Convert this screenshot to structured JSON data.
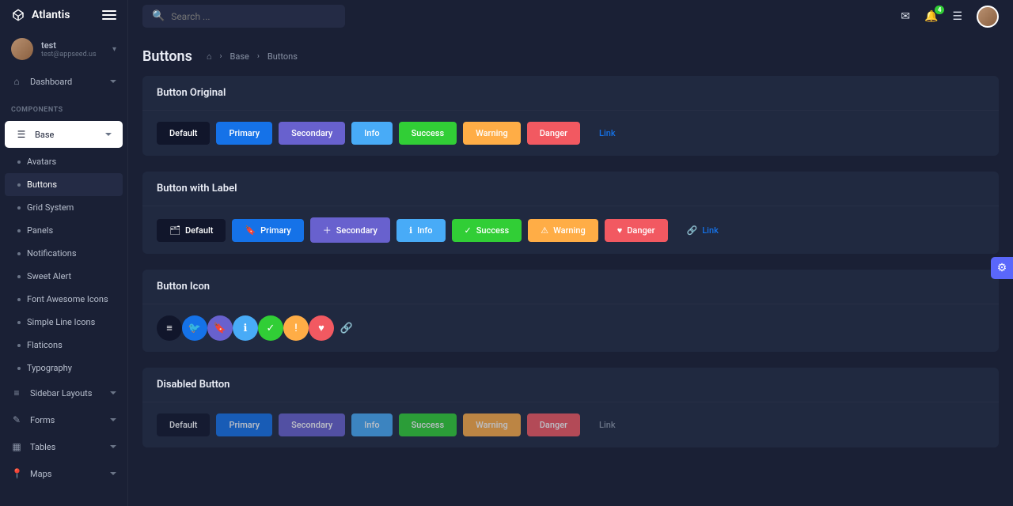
{
  "brand": "Atlantis",
  "search": {
    "placeholder": "Search ..."
  },
  "notification_badge": "4",
  "user": {
    "name": "test",
    "email": "test@appseed.us"
  },
  "sidebar": {
    "dashboard": "Dashboard",
    "section_components": "COMPONENTS",
    "base": "Base",
    "sub": {
      "avatars": "Avatars",
      "buttons": "Buttons",
      "grid": "Grid System",
      "panels": "Panels",
      "notifications": "Notifications",
      "sweetalert": "Sweet Alert",
      "fa": "Font Awesome Icons",
      "simple": "Simple Line Icons",
      "flaticons": "Flaticons",
      "typography": "Typography"
    },
    "layouts": "Sidebar Layouts",
    "forms": "Forms",
    "tables": "Tables",
    "maps": "Maps"
  },
  "page": {
    "title": "Buttons",
    "breadcrumb": {
      "l1": "Base",
      "l2": "Buttons"
    }
  },
  "cards": {
    "original": {
      "title": "Button Original",
      "default": "Default",
      "primary": "Primary",
      "secondary": "Secondary",
      "info": "Info",
      "success": "Success",
      "warning": "Warning",
      "danger": "Danger",
      "link": "Link"
    },
    "label": {
      "title": "Button with Label",
      "default": "Default",
      "primary": "Primary",
      "secondary": "Secondary",
      "info": "Info",
      "success": "Success",
      "warning": "Warning",
      "danger": "Danger",
      "link": "Link"
    },
    "icon": {
      "title": "Button Icon"
    },
    "disabled": {
      "title": "Disabled Button",
      "default": "Default",
      "primary": "Primary",
      "secondary": "Secondary",
      "info": "Info",
      "success": "Success",
      "warning": "Warning",
      "danger": "Danger",
      "link": "Link"
    }
  }
}
